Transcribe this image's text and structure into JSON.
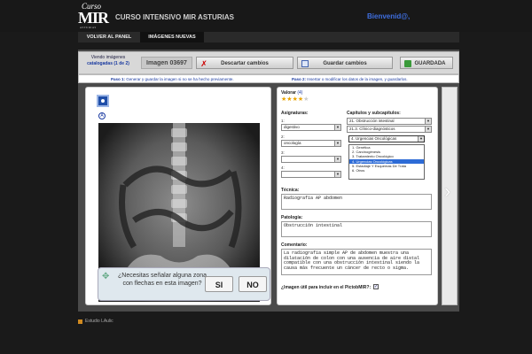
{
  "header": {
    "logo_top": "Curso",
    "logo_main": "MIR",
    "logo_sub": "ASTURIAS",
    "title": "CURSO INTENSIVO MIR ASTURIAS",
    "welcome": "Bienvenid@,"
  },
  "nav": {
    "tabs": [
      "VOLVER AL PANEL",
      "IMÁGENES NUEVAS"
    ]
  },
  "toolbar": {
    "viewing_line1": "Viendo imágenes",
    "viewing_line2": "catalogadas (1 de 2)",
    "image_label": "Imagen 03697",
    "discard_label": "Descartar cambios",
    "save_label": "Guardar cambios",
    "saved_label": "GUARDADA"
  },
  "steps": {
    "step1_title": "Paso 1:",
    "step1_text": "Generar y guardar la imagen si no se ha hecho previamente.",
    "step2_title": "Paso 2:",
    "step2_text": "Insertar o modificar los datos de la imagen, y guardarlos."
  },
  "rating": {
    "label": "Valorar",
    "count": "(4)",
    "filled": 4,
    "total": 5
  },
  "subjects": {
    "label": "Asignaturas:",
    "rows": [
      {
        "num": "1:",
        "value": "digestivo"
      },
      {
        "num": "2:",
        "value": "oncología"
      },
      {
        "num": "3:",
        "value": ""
      },
      {
        "num": "4:",
        "value": ""
      }
    ]
  },
  "chapters": {
    "label": "Capítulos y subcapítulos:",
    "rows": [
      "21. Obstrucción intestinal",
      "21.3. Clínico-diagnósticos",
      "4. Urgencias Oncológicas"
    ],
    "options": [
      "1. Genética",
      "2. Carcinogénesis",
      "3. Tratamiento Oncológico",
      "4. Urgencias Oncológicas",
      "5. Estadiaje Y Esquemas De Trata",
      "6. Otros"
    ],
    "highlighted_index": 3
  },
  "technique": {
    "label": "Técnica:",
    "value": "Radiografía AP abdomen"
  },
  "pathology": {
    "label": "Patología:",
    "value": "Obstrucción intestinal"
  },
  "comment": {
    "label": "Comentario:",
    "value": "La radiografía simple AP de abdomen muestra una dilatación de colon con una ausencia de aire distal compatible con una obstrucción intestinal siendo la causa más frecuente un cáncer de recto o sigma."
  },
  "pictobmir": {
    "label": "¿Imagen útil para incluir en el PictobMIR?:",
    "checked": "✓"
  },
  "annotate_prompt": {
    "question": "¿Necesitas señalar alguna zona con flechas en esta imagen?",
    "yes": "SI",
    "no": "NO"
  },
  "footer": {
    "text": "Estudio LAulic"
  }
}
